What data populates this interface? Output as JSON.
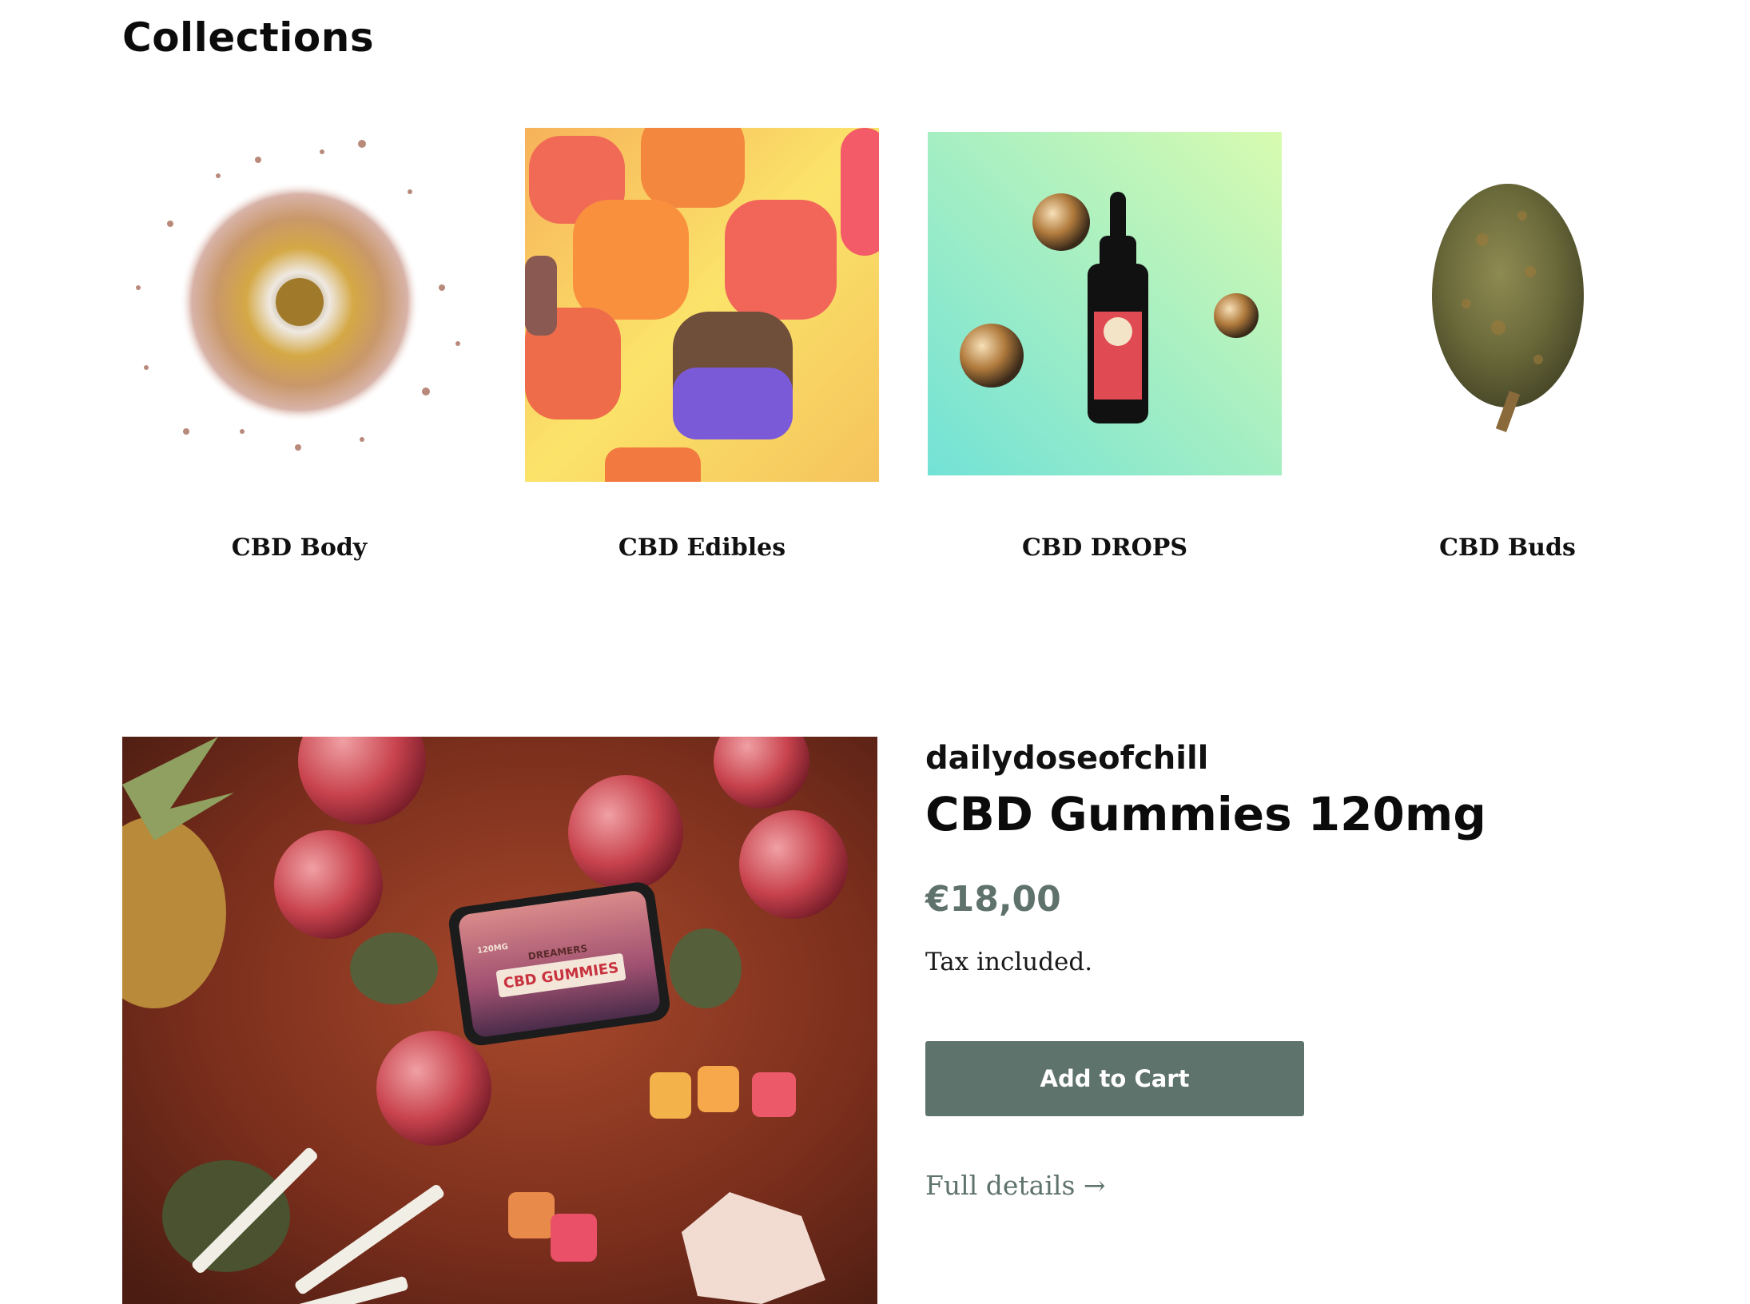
{
  "collections": {
    "heading": "Collections",
    "items": [
      {
        "label": "CBD Body",
        "image_icon": "cbd-body-image"
      },
      {
        "label": "CBD Edibles",
        "image_icon": "cbd-edibles-image"
      },
      {
        "label": "CBD DROPS",
        "image_icon": "cbd-drops-image"
      },
      {
        "label": "CBD Buds",
        "image_icon": "cbd-buds-image"
      }
    ]
  },
  "featured_product": {
    "vendor": "dailydoseofchill",
    "title": "CBD Gummies 120mg",
    "price": "€18,00",
    "tax_note": "Tax included.",
    "add_to_cart_label": "Add to Cart",
    "full_details_label": "Full details →",
    "image_icon": "cbd-gummies-product-image",
    "tin": {
      "brand": "DREAMERS",
      "name": "CBD GUMMIES",
      "dose": "120MG"
    }
  },
  "colors": {
    "accent": "#5f736d",
    "price": "#5f726c",
    "text": "#111111",
    "background": "#ffffff"
  }
}
